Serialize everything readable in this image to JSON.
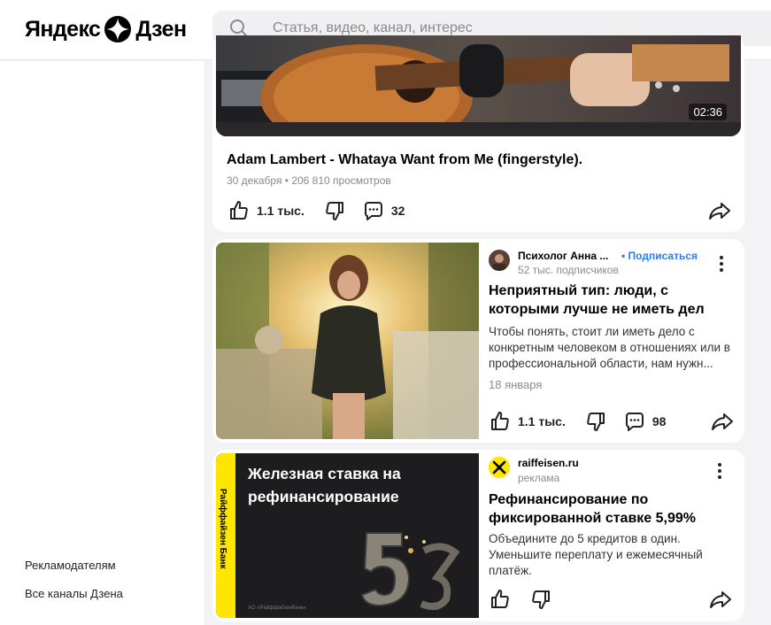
{
  "header": {
    "logo_left": "Яндекс",
    "logo_right": "Дзен",
    "search_placeholder": "Статья, видео, канал, интерес"
  },
  "sidebar": {
    "links": [
      "Рекламодателям",
      "Все каналы Дзена"
    ]
  },
  "video_card": {
    "duration": "02:36",
    "title": "Adam Lambert - Whataya Want from Me (fingerstyle).",
    "meta": "30 декабря • 206 810 просмотров",
    "likes": "1.1 тыс.",
    "comments": "32"
  },
  "article_card": {
    "channel": "Психолог Анна ...",
    "subscribe": "• Подписаться",
    "subscribers": "52 тыс. подписчиков",
    "title": "Неприятный тип: люди, с которыми лучше не иметь дел",
    "snippet": "Чтобы понять, стоит ли иметь дело с конкретным человеком в отношениях или в профессиональной области, нам нужн...",
    "date": "18 января",
    "likes": "1.1 тыс.",
    "comments": "98"
  },
  "ad_card": {
    "headline": "Железная ставка на рефинансирование",
    "bank_label": "Райффайзен Банк",
    "legal": "АО «Райффайзенбанк»",
    "domain": "raiffeisen.ru",
    "label": "реклама",
    "title": "Рефинансирование по фиксированной ставке 5,99%",
    "text": "Объедините до 5 кредитов в один. Уменьшите переплату и ежемесячный платёж."
  },
  "colors": {
    "accent_blue": "#2a7bf6",
    "raiffeisen_yellow": "#fee600",
    "page_bg": "#f3f3f5"
  },
  "icons": [
    "search-icon",
    "zen-logo-icon",
    "like-icon",
    "dislike-icon",
    "comments-icon",
    "share-icon",
    "more-icon"
  ]
}
